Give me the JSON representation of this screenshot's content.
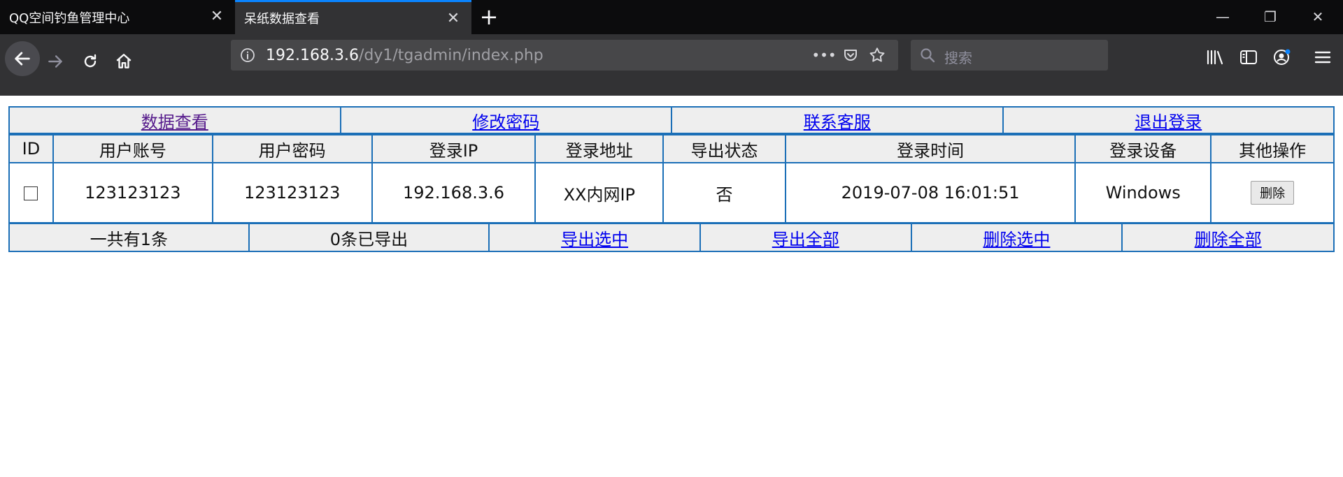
{
  "browser": {
    "tabs": [
      {
        "title": "QQ空间钓鱼管理中心",
        "close_icon": "close-icon"
      },
      {
        "title": "呆纸数据查看",
        "close_icon": "close-icon",
        "active": true
      }
    ],
    "new_tab_glyph": "+",
    "window_controls": {
      "minimize": "—",
      "restore": "❐",
      "close": "✕"
    },
    "url": {
      "host": "192.168.3.6",
      "path": "/dy1/tgadmin/index.php"
    },
    "url_menu": "•••",
    "search_placeholder": "搜索",
    "accent_color": "#0a84ff"
  },
  "page": {
    "nav_links": [
      "数据查看",
      "修改密码",
      "联系客服",
      "退出登录"
    ],
    "columns": [
      "ID",
      "用户账号",
      "用户密码",
      "登录IP",
      "登录地址",
      "导出状态",
      "登录时间",
      "登录设备",
      "其他操作"
    ],
    "rows": [
      {
        "account": "123123123",
        "password": "123123123",
        "ip": "192.168.3.6",
        "location": "XX内网IP",
        "export_status": "否",
        "login_time": "2019-07-08 16:01:51",
        "device": "Windows",
        "action": "删除"
      }
    ],
    "footer": {
      "total": "一共有1条",
      "exported": "0条已导出",
      "links": [
        "导出选中",
        "导出全部",
        "删除选中",
        "删除全部"
      ]
    },
    "border_color": "#1b6fb7",
    "link_color": "#0000ee"
  }
}
